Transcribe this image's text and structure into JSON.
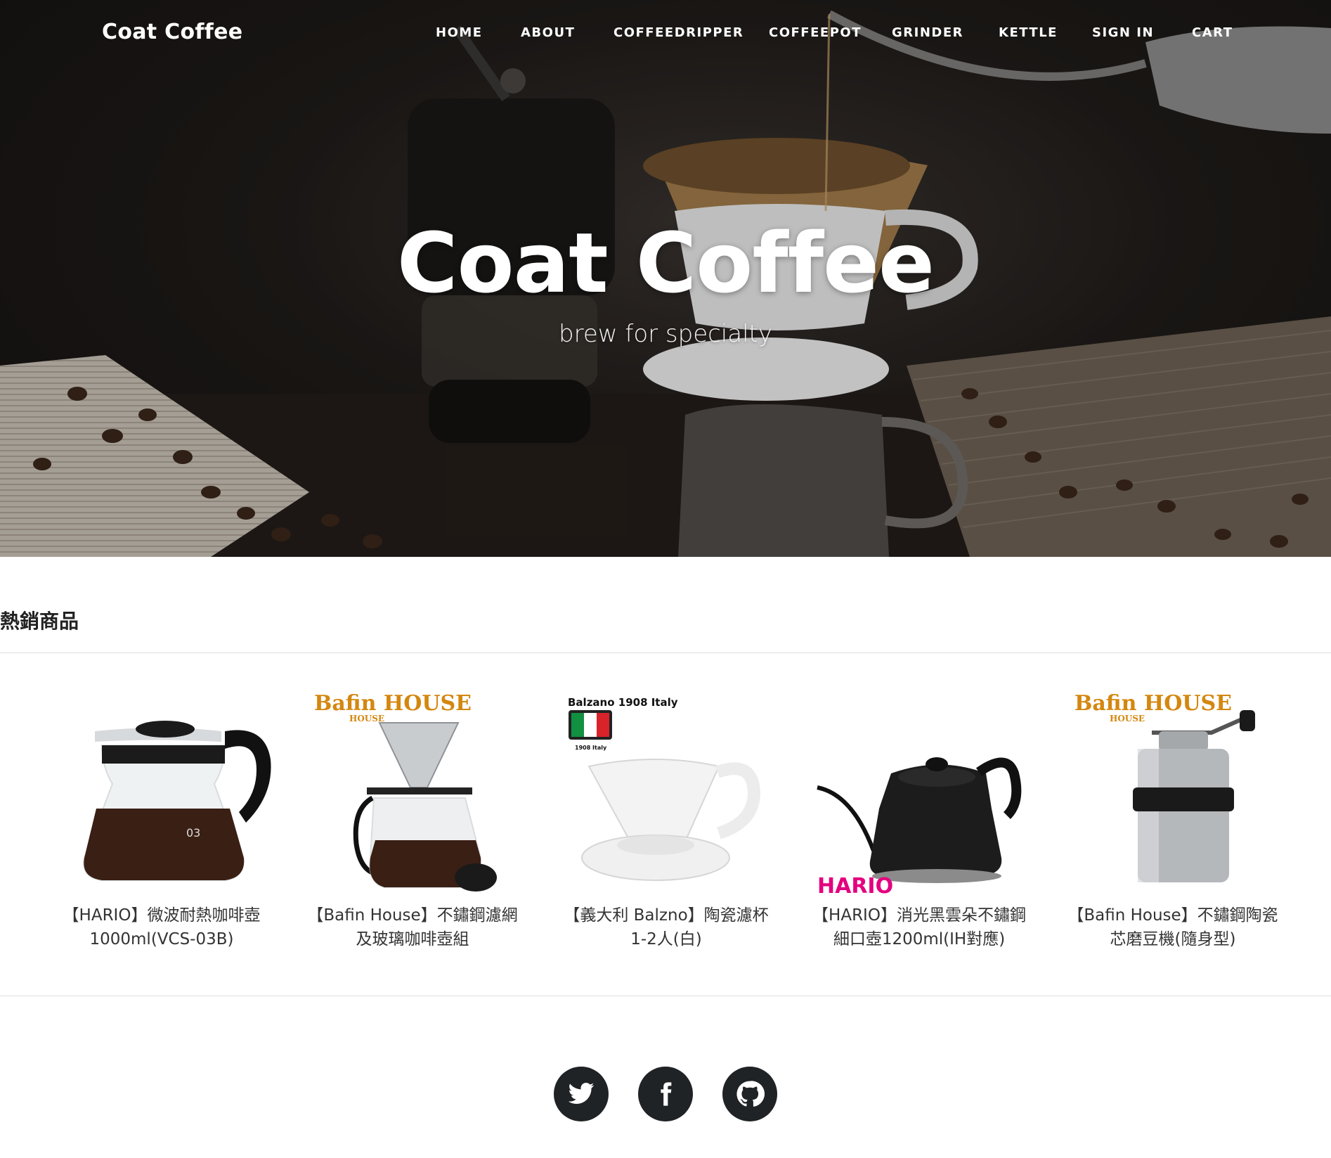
{
  "site": {
    "brand": "Coat Coffee",
    "nav": [
      "HOME",
      "ABOUT",
      "COFFEEDRIPPER",
      "COFFEEPOT",
      "GRINDER",
      "KETTLE",
      "SIGN IN",
      "CART"
    ]
  },
  "hero": {
    "title": "Coat Coffee",
    "subtitle": "brew for specialty"
  },
  "bestsellers": {
    "heading": "熱銷商品",
    "products": [
      {
        "line1": "【HARIO】微波耐熱咖啡壺",
        "line2": "1000ml(VCS-03B)",
        "logo": ""
      },
      {
        "line1": "【Bafin House】不鏽鋼濾網",
        "line2": "及玻璃咖啡壺組",
        "logo": "Bafin HOUSE"
      },
      {
        "line1": "【義大利 Balzno】陶瓷濾杯",
        "line2": "1-2人(白)",
        "logo": "Balzano 1908 Italy"
      },
      {
        "line1": "【HARIO】消光黑雲朵不鏽鋼",
        "line2": "細口壺1200ml(IH對應)",
        "logo": "HARIO"
      },
      {
        "line1": "【Bafin House】不鏽鋼陶瓷",
        "line2": "芯磨豆機(隨身型)",
        "logo": "Bafin HOUSE"
      }
    ]
  },
  "social": [
    {
      "icon": "twitter-icon"
    },
    {
      "icon": "facebook-icon"
    },
    {
      "icon": "github-icon"
    }
  ],
  "colors": {
    "hero_dark": "#1f1b19",
    "social_circle": "#1f2326",
    "hario_logo": "#e4007f",
    "bafin_logo": "#d4870f"
  }
}
